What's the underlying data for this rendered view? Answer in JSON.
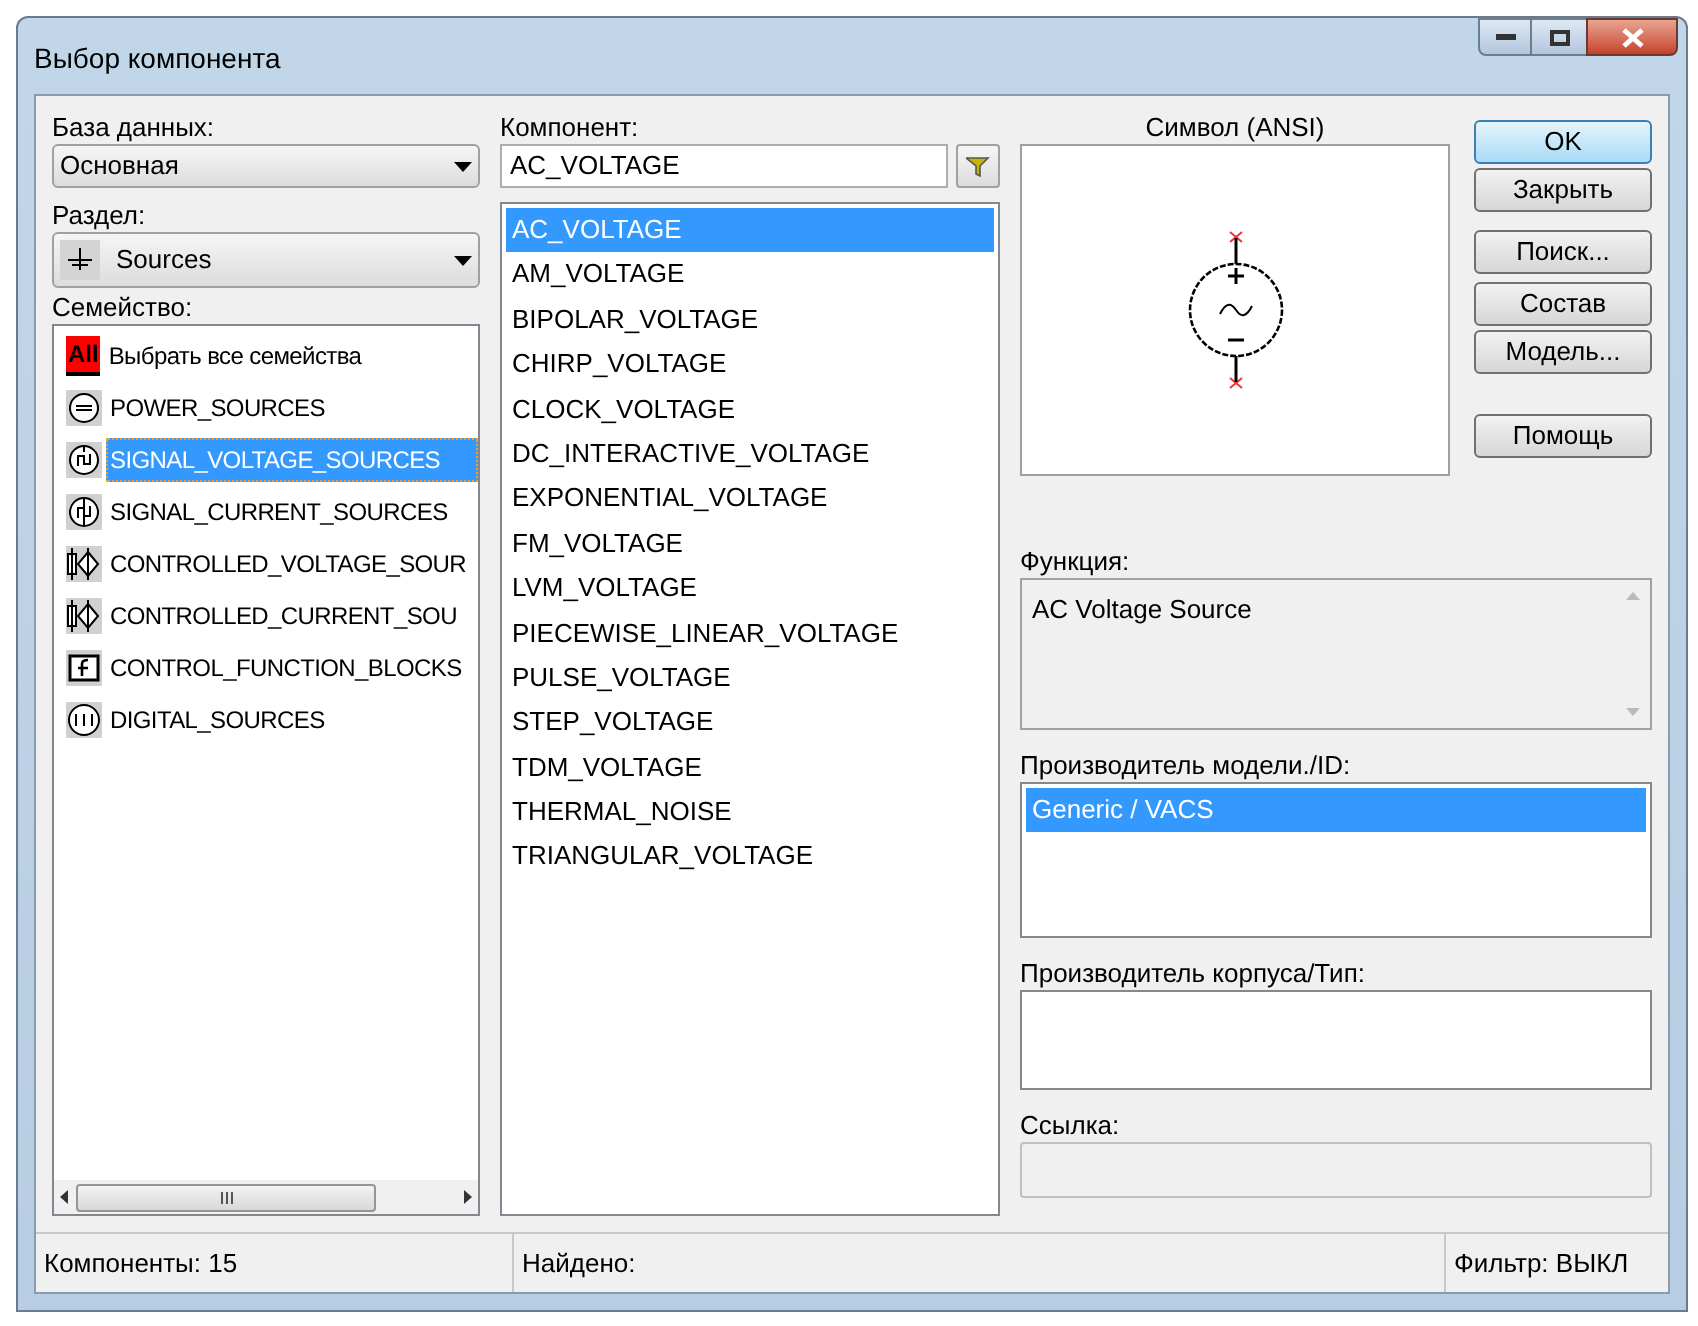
{
  "window": {
    "title": "Выбор компонента"
  },
  "database": {
    "label": "База данных:",
    "value": "Основная"
  },
  "section": {
    "label": "Раздел:",
    "value": "Sources"
  },
  "family": {
    "label": "Семейство:",
    "items": [
      {
        "kind": "all",
        "icon_text": "All",
        "label": "Выбрать все семейства",
        "selected": false
      },
      {
        "kind": "power",
        "label": "POWER_SOURCES",
        "selected": false
      },
      {
        "kind": "signal-voltage",
        "label": "SIGNAL_VOLTAGE_SOURCES",
        "selected": true
      },
      {
        "kind": "signal-current",
        "label": "SIGNAL_CURRENT_SOURCES",
        "selected": false
      },
      {
        "kind": "controlled",
        "label": "CONTROLLED_VOLTAGE_SOUR",
        "selected": false
      },
      {
        "kind": "controlled",
        "label": "CONTROLLED_CURRENT_SOU",
        "selected": false
      },
      {
        "kind": "function",
        "label": "CONTROL_FUNCTION_BLOCKS",
        "selected": false
      },
      {
        "kind": "digital",
        "label": "DIGITAL_SOURCES",
        "selected": false
      }
    ]
  },
  "component": {
    "label": "Компонент:",
    "value": "AC_VOLTAGE",
    "items": [
      {
        "label": "AC_VOLTAGE",
        "selected": true
      },
      {
        "label": "AM_VOLTAGE",
        "selected": false
      },
      {
        "label": "BIPOLAR_VOLTAGE",
        "selected": false
      },
      {
        "label": "CHIRP_VOLTAGE",
        "selected": false
      },
      {
        "label": "CLOCK_VOLTAGE",
        "selected": false
      },
      {
        "label": "DC_INTERACTIVE_VOLTAGE",
        "selected": false
      },
      {
        "label": "EXPONENTIAL_VOLTAGE",
        "selected": false
      },
      {
        "label": "FM_VOLTAGE",
        "selected": false
      },
      {
        "label": "LVM_VOLTAGE",
        "selected": false
      },
      {
        "label": "PIECEWISE_LINEAR_VOLTAGE",
        "selected": false
      },
      {
        "label": "PULSE_VOLTAGE",
        "selected": false
      },
      {
        "label": "STEP_VOLTAGE",
        "selected": false
      },
      {
        "label": "TDM_VOLTAGE",
        "selected": false
      },
      {
        "label": "THERMAL_NOISE",
        "selected": false
      },
      {
        "label": "TRIANGULAR_VOLTAGE",
        "selected": false
      }
    ]
  },
  "symbol": {
    "title": "Символ (ANSI)"
  },
  "function": {
    "label": "Функция:",
    "value": "AC Voltage Source"
  },
  "model_manufacturer": {
    "label": "Производитель модели./ID:",
    "items": [
      {
        "label": "Generic / VACS",
        "selected": true
      }
    ]
  },
  "package_manufacturer": {
    "label": "Производитель корпуса/Тип:"
  },
  "link": {
    "label": "Ссылка:"
  },
  "buttons": [
    {
      "label": "OK",
      "default": true
    },
    {
      "label": "Закрыть",
      "default": false
    },
    {
      "label": "Поиск...",
      "default": false
    },
    {
      "label": "Состав",
      "default": false
    },
    {
      "label": "Модель...",
      "default": false
    },
    {
      "label": "Помощь",
      "default": false
    }
  ],
  "status_bar": [
    "Компоненты: 15",
    "Найдено:",
    "Фильтр: ВЫКЛ"
  ]
}
